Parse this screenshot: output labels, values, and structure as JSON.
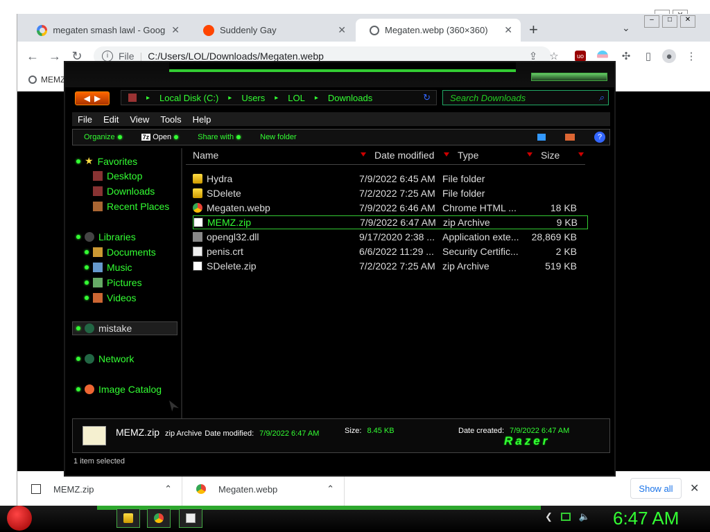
{
  "browser": {
    "tabs": [
      {
        "title": "megaten smash lawl - Google Se",
        "icon": "google-icon",
        "active": false
      },
      {
        "title": "Suddenly Gay",
        "icon": "reddit-icon",
        "active": false
      },
      {
        "title": "Megaten.webp (360×360)",
        "icon": "globe-icon",
        "active": true
      }
    ],
    "new_tab": "+",
    "address": {
      "label": "File",
      "url": "C:/Users/LOL/Downloads/Megaten.webp"
    },
    "bookmark_label": "MEMZ",
    "downloads": [
      {
        "name": "MEMZ.zip",
        "icon": "zip-icon"
      },
      {
        "name": "Megaten.webp",
        "icon": "chrome-icon"
      }
    ],
    "show_all": "Show all"
  },
  "explorer": {
    "breadcrumb": [
      "Local Disk (C:)",
      "Users",
      "LOL",
      "Downloads"
    ],
    "search_placeholder": "Search Downloads",
    "menu": [
      "File",
      "Edit",
      "View",
      "Tools",
      "Help"
    ],
    "commands": {
      "organize": "Organize",
      "open": "Open",
      "open_prefix": "7z",
      "share": "Share with",
      "new_folder": "New folder"
    },
    "nav": {
      "favorites": "Favorites",
      "favorites_items": [
        "Desktop",
        "Downloads",
        "Recent Places"
      ],
      "libraries": "Libraries",
      "libraries_items": [
        "Documents",
        "Music",
        "Pictures",
        "Videos"
      ],
      "selected": "mistake",
      "network": "Network",
      "image_catalog": "Image Catalog"
    },
    "columns": [
      "Name",
      "Date modified",
      "Type",
      "Size"
    ],
    "files": [
      {
        "name": "Hydra",
        "date": "7/9/2022 6:45 AM",
        "type": "File folder",
        "size": "",
        "icon": "folder"
      },
      {
        "name": "SDelete",
        "date": "7/2/2022 7:25 AM",
        "type": "File folder",
        "size": "",
        "icon": "folder"
      },
      {
        "name": "Megaten.webp",
        "date": "7/9/2022 6:46 AM",
        "type": "Chrome HTML ...",
        "size": "18 KB",
        "icon": "chrome"
      },
      {
        "name": "MEMZ.zip",
        "date": "7/9/2022 6:47 AM",
        "type": "zip Archive",
        "size": "9 KB",
        "icon": "zip"
      },
      {
        "name": "opengl32.dll",
        "date": "9/17/2020 2:38 ...",
        "type": "Application exte...",
        "size": "28,869 KB",
        "icon": "dll"
      },
      {
        "name": "penis.crt",
        "date": "6/6/2022 11:29 ...",
        "type": "Security Certific...",
        "size": "2 KB",
        "icon": "crt"
      },
      {
        "name": "SDelete.zip",
        "date": "7/2/2022 7:25 AM",
        "type": "zip Archive",
        "size": "519 KB",
        "icon": "zip"
      }
    ],
    "selected_index": 3,
    "details": {
      "name": "MEMZ.zip",
      "type": "zip Archive",
      "date_modified_label": "Date modified:",
      "date_modified": "7/9/2022 6:47 AM",
      "size_label": "Size:",
      "size": "8.45 KB",
      "date_created_label": "Date created:",
      "date_created": "7/9/2022 6:47 AM"
    },
    "theme_logo": "Razer",
    "status": "1 item selected"
  },
  "taskbar": {
    "clock": "6:47 AM"
  },
  "colors": {
    "accent": "#33ff33",
    "chrome_tabbar": "#dee1e6",
    "link_blue": "#1a73e8"
  }
}
